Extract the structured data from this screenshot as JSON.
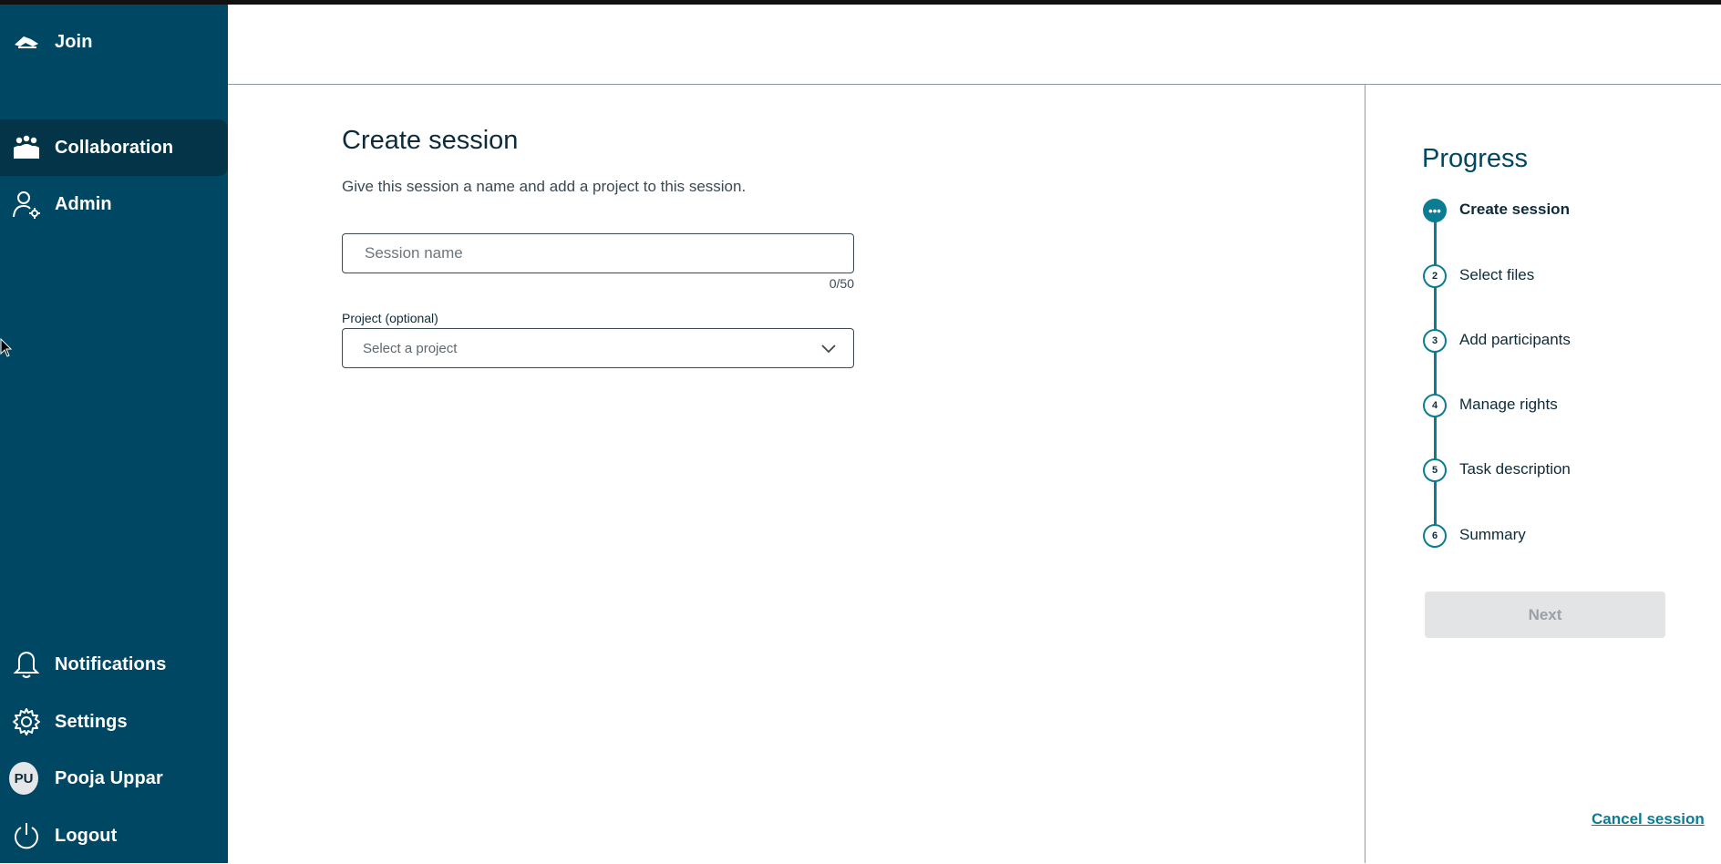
{
  "sidebar": {
    "top_items": [
      {
        "label": "Join",
        "icon": "handshake-icon"
      },
      {
        "label": "Collaboration",
        "icon": "group-icon",
        "active": true
      },
      {
        "label": "Admin",
        "icon": "user-gear-icon"
      }
    ],
    "bottom_items": [
      {
        "label": "Notifications",
        "icon": "bell-icon"
      },
      {
        "label": "Settings",
        "icon": "gear-icon"
      },
      {
        "label": "Pooja Uppar",
        "avatar_initials": "PU"
      },
      {
        "label": "Logout",
        "icon": "power-icon"
      }
    ],
    "background_color": "#004763",
    "active_color": "#033448"
  },
  "main": {
    "title": "Create session",
    "subtitle": "Give this session a name and add a project to this session.",
    "session_name": {
      "value": "",
      "placeholder": "Session name",
      "counter": "0/50"
    },
    "project": {
      "label": "Project (optional)",
      "selected": "Select a project"
    }
  },
  "progress": {
    "title": "Progress",
    "steps": [
      {
        "marker": "•••",
        "label": "Create session",
        "current": true
      },
      {
        "marker": "2",
        "label": "Select files"
      },
      {
        "marker": "3",
        "label": "Add participants"
      },
      {
        "marker": "4",
        "label": "Manage rights"
      },
      {
        "marker": "5",
        "label": "Task description"
      },
      {
        "marker": "6",
        "label": "Summary"
      }
    ],
    "next_label": "Next",
    "cancel_label": "Cancel session",
    "accent_color": "#0c7c93"
  }
}
